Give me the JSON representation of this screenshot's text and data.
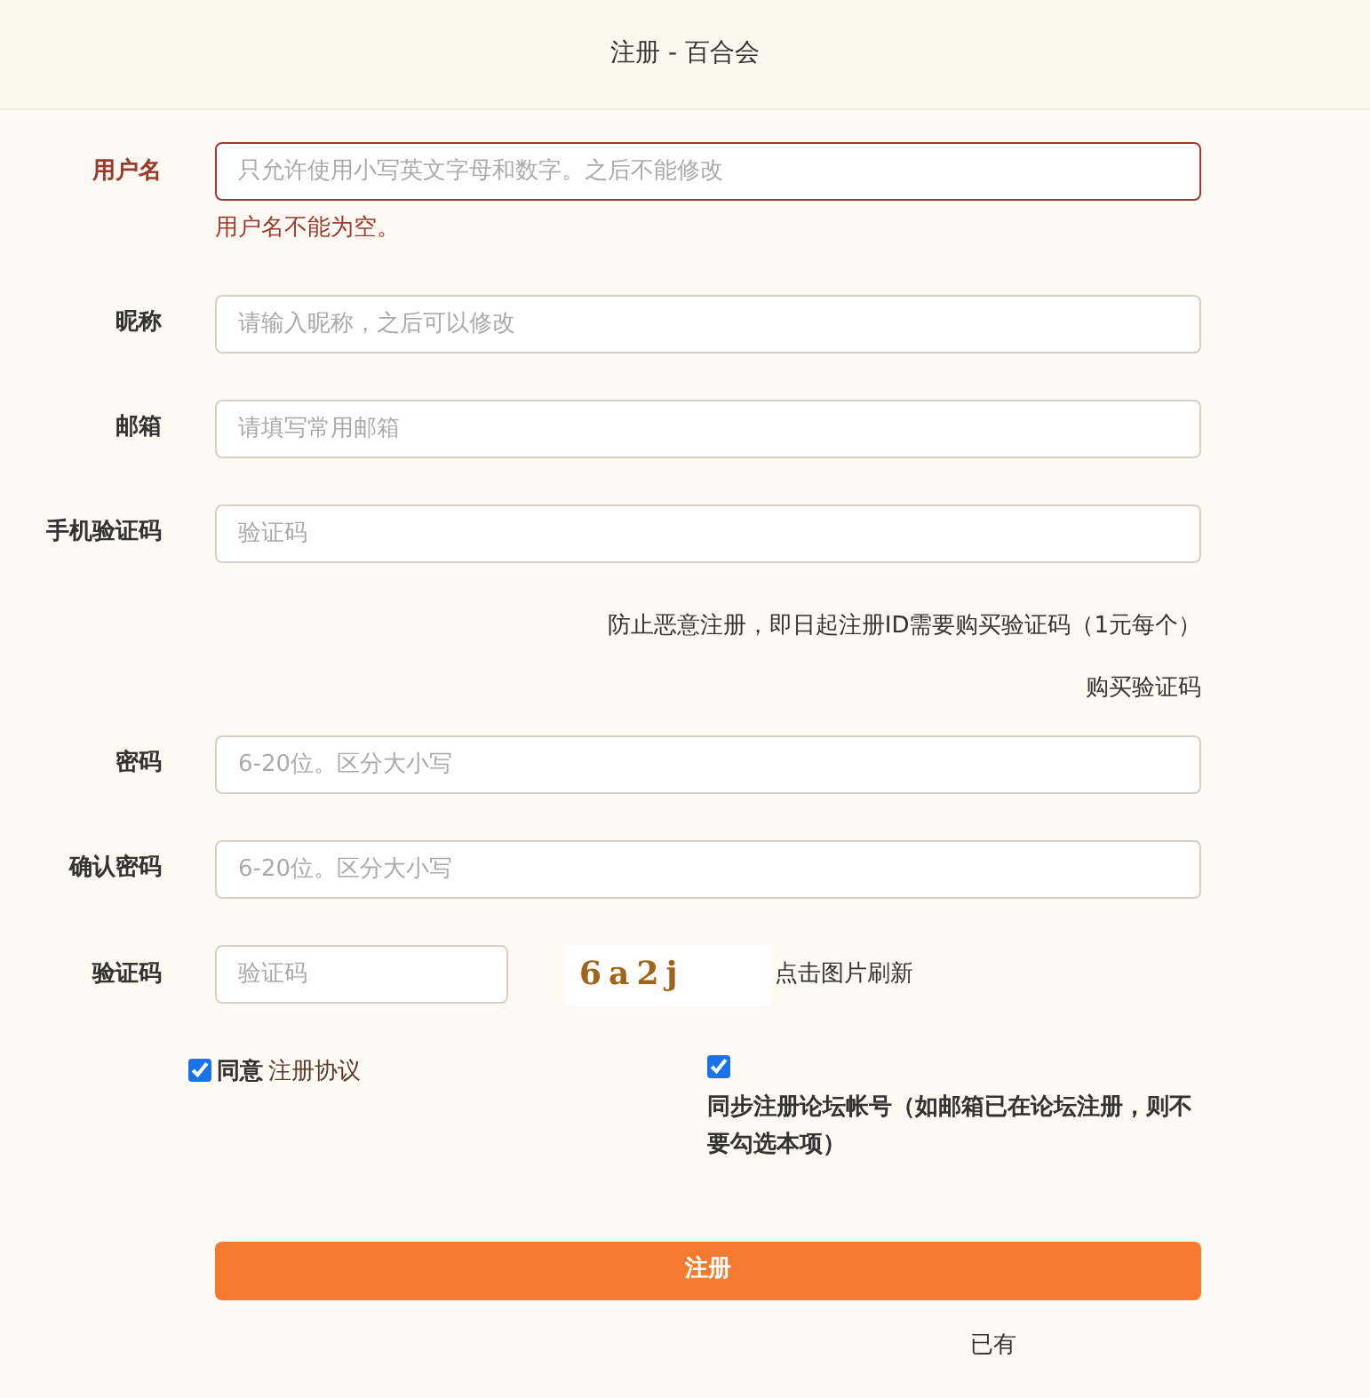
{
  "window": {
    "title": "注册 - 百合会"
  },
  "fields": [
    {
      "label": "用户名",
      "placeholder": "只允许使用小写英文字母和数字。之后不能修改",
      "invalid": true,
      "error": "用户名不能为空。"
    },
    {
      "label": "昵称",
      "placeholder": "请输入昵称，之后可以修改",
      "invalid": false
    },
    {
      "label": "邮箱",
      "placeholder": "请填写常用邮箱",
      "invalid": false
    },
    {
      "label": "手机验证码",
      "placeholder": "验证码",
      "invalid": false
    }
  ],
  "notice": "防止恶意注册，即日起注册ID需要购买验证码（1元每个）",
  "buy_link": "购买验证码",
  "password_fields": [
    {
      "label": "密码",
      "placeholder": "6-20位。区分大小写",
      "invalid": false
    },
    {
      "label": "确认密码",
      "placeholder": "6-20位。区分大小写",
      "invalid": false
    }
  ],
  "captcha": {
    "label": "验证码",
    "placeholder": "验证码",
    "image_text": "6a2j",
    "refresh_hint": "点击图片刷新"
  },
  "agreement": {
    "checked": true,
    "label": "同意",
    "link": "注册协议"
  },
  "sync": {
    "checked": true,
    "label": "同步注册论坛帐号（如邮箱已在论坛注册，则不要勾选本项）"
  },
  "submit": "注册",
  "footer": "已有"
}
